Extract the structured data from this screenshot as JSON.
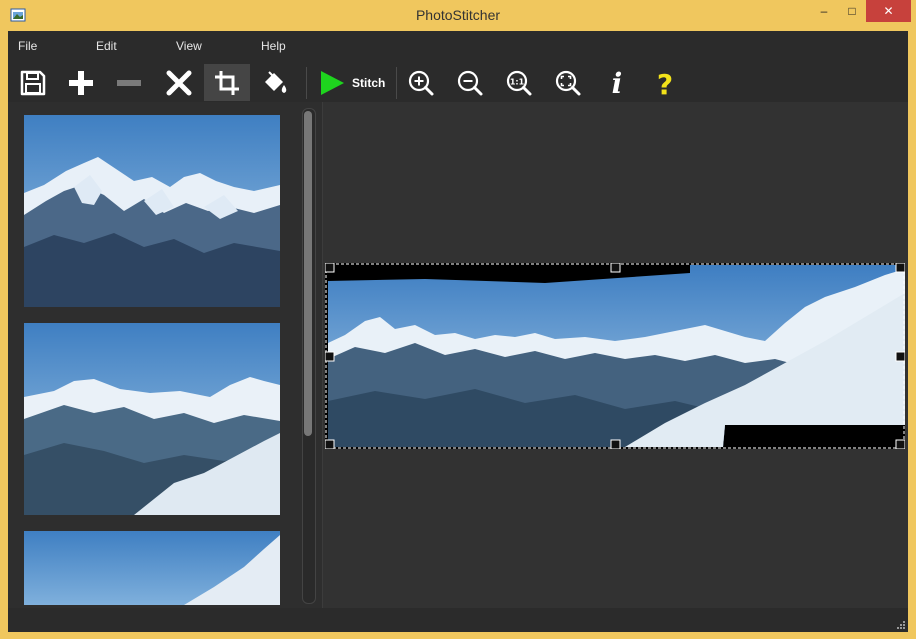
{
  "window": {
    "title": "PhotoStitcher"
  },
  "titlebar": {
    "minimize": "–",
    "maximize": "□",
    "close": "✕"
  },
  "menu": [
    {
      "label": "File"
    },
    {
      "label": "Edit"
    },
    {
      "label": "View"
    },
    {
      "label": "Help"
    }
  ],
  "toolbar": {
    "stitch_label": "Stitch",
    "zoom_actual_label": "1:1",
    "info_label": "i",
    "help_label": "?",
    "icons": [
      "save-icon",
      "add-icon",
      "remove-icon",
      "delete-icon",
      "crop-icon",
      "fill-icon",
      "stitch-play-icon",
      "zoom-in-icon",
      "zoom-out-icon",
      "zoom-actual-icon",
      "zoom-fit-icon",
      "info-icon",
      "help-icon"
    ],
    "colors": {
      "stitch_green": "#1ed41e",
      "help_yellow": "#f2e21a",
      "background": "#2b2b2b"
    }
  },
  "thumbnails": [
    {
      "name": "photo-1"
    },
    {
      "name": "photo-2"
    },
    {
      "name": "photo-3"
    }
  ]
}
